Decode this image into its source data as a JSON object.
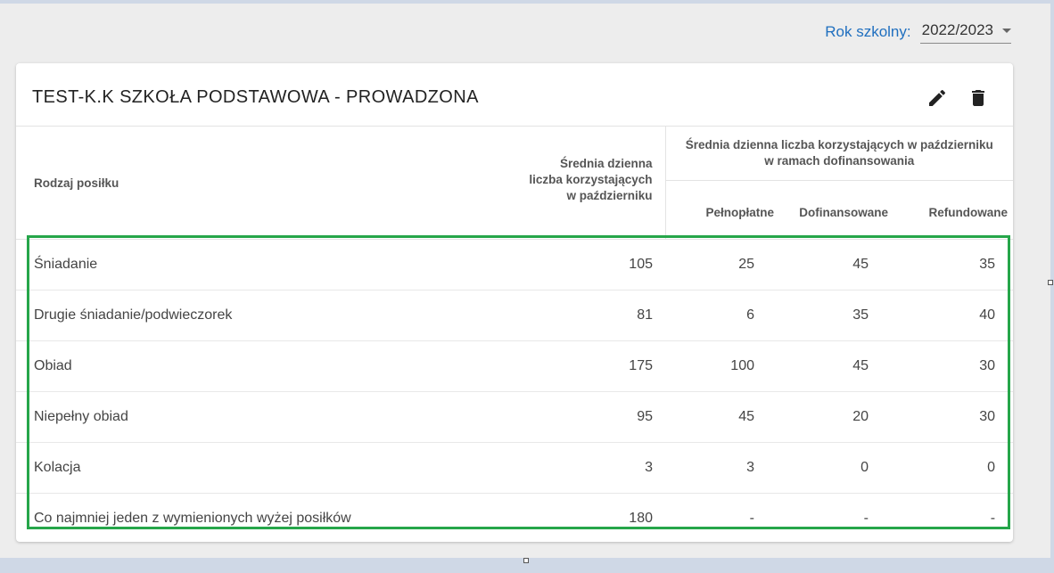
{
  "filter": {
    "label": "Rok szkolny:",
    "selected": "2022/2023"
  },
  "card": {
    "title": "TEST-K.K SZKOŁA PODSTAWOWA - PROWADZONA"
  },
  "icons": {
    "edit": "pencil-icon",
    "delete": "trash-icon"
  },
  "table": {
    "headers": {
      "type": "Rodzaj posiłku",
      "avg_line1": "Średnia dzienna",
      "avg_line2": "liczba korzystających",
      "avg_line3": "w październiku",
      "group_line1": "Średnia dzienna liczba korzystających w październiku",
      "group_line2": "w ramach dofinansowania",
      "full": "Pełnopłatne",
      "cofinanced": "Dofinansowane",
      "refunded": "Refundowane"
    },
    "rows": [
      {
        "name": "Śniadanie",
        "avg": "105",
        "full": "25",
        "cofinanced": "45",
        "refunded": "35"
      },
      {
        "name": "Drugie śniadanie/podwieczorek",
        "avg": "81",
        "full": "6",
        "cofinanced": "35",
        "refunded": "40"
      },
      {
        "name": "Obiad",
        "avg": "175",
        "full": "100",
        "cofinanced": "45",
        "refunded": "30"
      },
      {
        "name": "Niepełny obiad",
        "avg": "95",
        "full": "45",
        "cofinanced": "20",
        "refunded": "30"
      },
      {
        "name": "Kolacja",
        "avg": "3",
        "full": "3",
        "cofinanced": "0",
        "refunded": "0"
      },
      {
        "name": "Co najmniej jeden z wymienionych wyżej posiłków",
        "avg": "180",
        "full": "-",
        "cofinanced": "-",
        "refunded": "-"
      }
    ]
  },
  "colors": {
    "accent": "#1f6fbf",
    "highlight": "#26a64a"
  }
}
